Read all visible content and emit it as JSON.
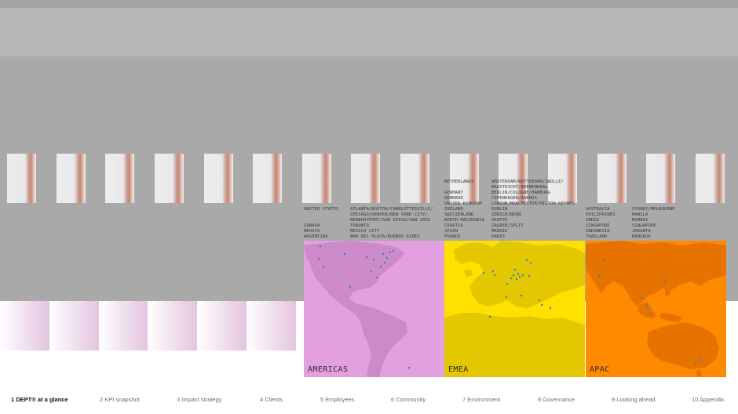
{
  "regions": [
    {
      "name": "AMERICAS",
      "color": "#e3a0df",
      "countries": "UNITED STATES\n\n\nCANADA\nMEXICO\nARGENTINA",
      "cities": "ATLANTA/BOSTON/CHARLOTTESVILLE/\nCHICAGO/DENVER/NEW YORK CITY/\nNEWBURYPORT/SAN DIEGO/SAN JOSE\nTORONTO\nMEXICO CITY\nMAR DEL PLATA/BUENOS AIRES"
    },
    {
      "name": "EMEA",
      "color": "#ffe100",
      "countries": "NETHERLANDS\n\nGERMANY\nDENMARK\nUNITED KINGDOM\nIRELAND\nSWITZERLAND\nNORTH MACEDONIA\nCROATIA\nSPAIN\nFRANCE",
      "cities": "AMSTERDAM/ROTTERDAM/ZWOLLE/\nMAASTRICHT/VEENENDAAL\nBERLIN/COLOGNE/HAMBURG\nCOPENHAGEN/AARHUS\nLONDON/MANCHESTER/MILTON KEYNES\nDUBLIN\nZÜRICH/BERN\nSKOPJE\nZAGREB/SPLIT\nMADRID\nPARIS"
    },
    {
      "name": "APAC",
      "color": "#ff8a00",
      "countries": "AUSTRALIA\nPHILIPPINES\nINDIA\nSINGAPORE\nINDONESIA\nTHAILAND",
      "cities": "SYDNEY/MELBOURNE\nMANILA\nMUMBAI\nSINGAPORE\nJAKARTA\nBANGKOK"
    }
  ],
  "nav": {
    "items": [
      {
        "label": "1  DEPT® at a glance",
        "active": true
      },
      {
        "label": "2  KPI snapshot",
        "active": false
      },
      {
        "label": "3  Impact strategy",
        "active": false
      },
      {
        "label": "4  Clients",
        "active": false
      },
      {
        "label": "5  Employees",
        "active": false
      },
      {
        "label": "6  Community",
        "active": false
      },
      {
        "label": "7  Environment",
        "active": false
      },
      {
        "label": "8  Governance",
        "active": false
      },
      {
        "label": "9  Looking ahead",
        "active": false
      },
      {
        "label": "10  Appendix",
        "active": false
      }
    ]
  },
  "colors": {
    "office_dot": "#2f7fd1",
    "landmass_americas": "#cc8ac8",
    "landmass_emea": "#e3c700",
    "landmass_apac": "#e67300"
  }
}
